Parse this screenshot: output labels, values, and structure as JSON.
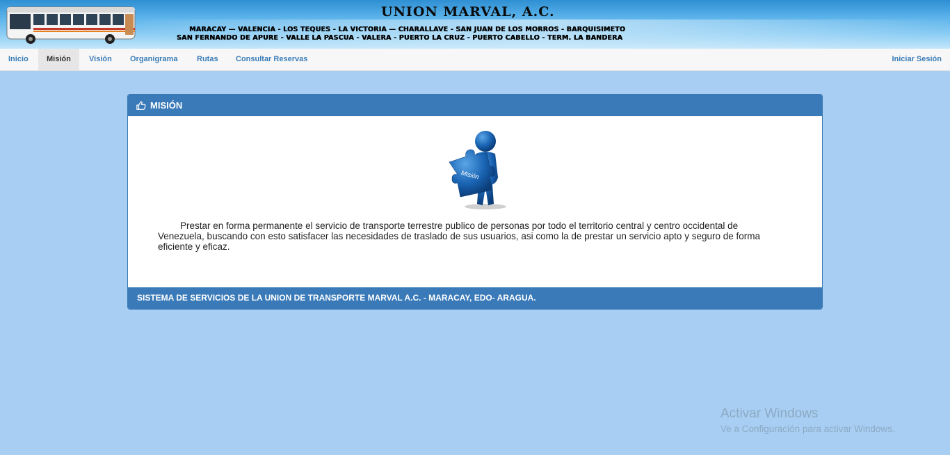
{
  "banner": {
    "title": "UNION MARVAL, A.C.",
    "routes_line1": "MARACAY — VALENCIA - LOS TEQUES - LA VICTORIA — CHARALLAVE - SAN JUAN DE LOS MORROS - BARQUISIMETO",
    "routes_line2": "SAN FERNANDO DE APURE - VALLE  LA PASCUA - VALERA - PUERTO LA CRUZ - PUERTO CABELLO - TERM. LA BANDERA"
  },
  "nav": {
    "items": [
      "Inicio",
      "Misión",
      "Visión",
      "Organigrama",
      "Rutas",
      "Consultar Reservas"
    ],
    "active": "Misión",
    "login": "Iniciar Sesión"
  },
  "panel": {
    "heading": "MISIÓN",
    "figure_label": "Misión",
    "text": "Prestar en forma permanente el servicio de transporte terrestre publico de personas por todo el territorio central y centro occidental de Venezuela, buscando con esto satisfacer las necesidades de traslado de sus usuarios, asi como la de prestar un servicio apto y seguro de forma eficiente y eficaz.",
    "footer": "SISTEMA DE SERVICIOS DE LA UNION DE TRANSPORTE MARVAL A.C. - MARACAY, EDO- ARAGUA."
  },
  "watermark": {
    "title": "Activar Windows",
    "subtitle": "Ve a Configuración para activar Windows."
  },
  "colors": {
    "page_bg": "#a8cff3",
    "panel_header": "#3a7ab8",
    "nav_link": "#3a7db8"
  }
}
